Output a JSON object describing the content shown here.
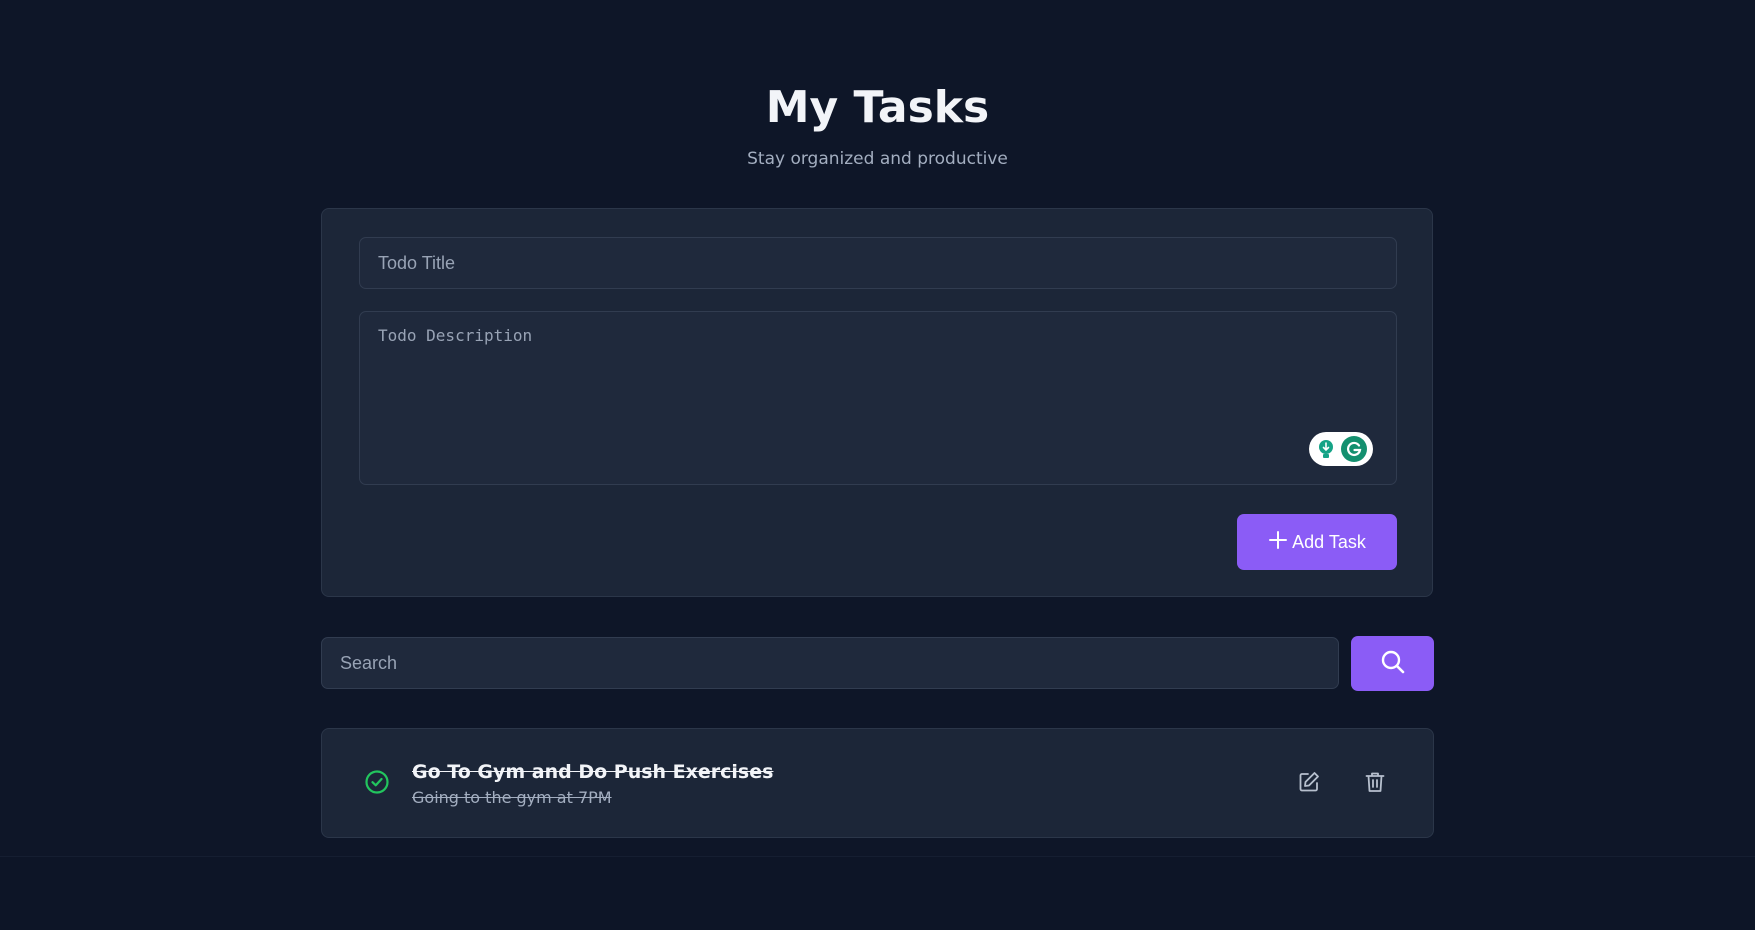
{
  "header": {
    "title": "My Tasks",
    "subtitle": "Stay organized and productive"
  },
  "form": {
    "title_placeholder": "Todo Title",
    "title_value": "",
    "description_placeholder": "Todo Description",
    "description_value": "",
    "add_button_label": "Add Task",
    "add_icon": "plus-icon",
    "grammarly_icons": [
      "lightbulb-icon",
      "grammarly-logo-icon"
    ]
  },
  "search": {
    "placeholder": "Search",
    "value": "",
    "button_icon": "search-icon"
  },
  "tasks": [
    {
      "title": "Go To Gym and Do Push Exercises",
      "description": "Going to the gym at 7PM",
      "completed": true,
      "status_icon": "check-circle-icon",
      "actions": [
        "edit-icon",
        "trash-icon"
      ]
    }
  ],
  "colors": {
    "background": "#0e1628",
    "card": "#1c2638",
    "accent": "#8b5cf6",
    "success": "#22c55e",
    "text": "#f2f4f8",
    "muted": "#a3aec0"
  }
}
